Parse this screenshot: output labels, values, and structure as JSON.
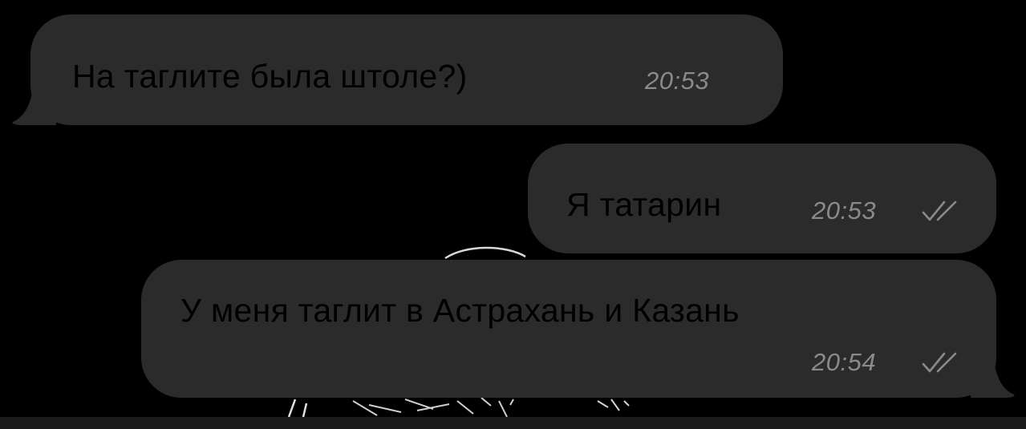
{
  "chat": {
    "messages": [
      {
        "direction": "incoming",
        "text": "На таглите была штоле?)",
        "time": "20:53",
        "read": false
      },
      {
        "direction": "outgoing",
        "text": "Я татарин",
        "time": "20:53",
        "read": true
      },
      {
        "direction": "outgoing",
        "text": "У меня таглит в Астрахань и Казань",
        "time": "20:54",
        "read": true
      }
    ]
  },
  "colors": {
    "background": "#000000",
    "bubble": "#2b2b2b",
    "text": "#ffffff",
    "meta": "#8a8a8a",
    "bottom_bar": "#1c1c1c"
  },
  "icons": {
    "read_receipt": "double-check-icon"
  }
}
